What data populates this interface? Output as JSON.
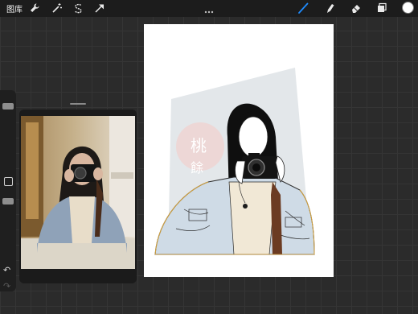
{
  "toolbar": {
    "gallery_label": "图库",
    "tools_left": [
      "wrench-icon",
      "magic-wand-icon",
      "selection-s-icon",
      "transform-arrow-icon"
    ],
    "tools_right": [
      "brush-icon",
      "smudge-icon",
      "eraser-icon",
      "layers-icon"
    ],
    "active_tool": "brush-icon",
    "accent_color": "#1e8cff",
    "current_color": "#ffffff"
  },
  "sidebar": {
    "undo_icon": "undo-arrow-icon",
    "redo_icon": "redo-arrow-icon"
  },
  "canvas": {
    "seal_text": "桃\n餘",
    "seal_color": "#e6b8b4"
  }
}
